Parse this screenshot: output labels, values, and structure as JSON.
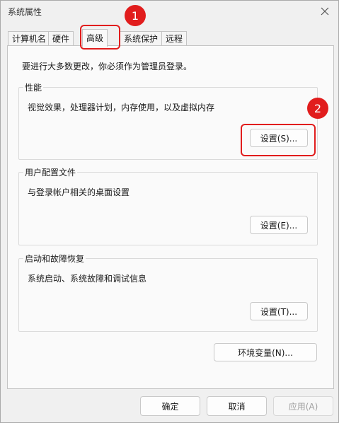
{
  "window": {
    "title": "系统属性"
  },
  "tabs": [
    {
      "label": "计算机名",
      "active": false
    },
    {
      "label": "硬件",
      "active": false
    },
    {
      "label": "高级",
      "active": true
    },
    {
      "label": "系统保护",
      "active": false
    },
    {
      "label": "远程",
      "active": false
    }
  ],
  "admin_note": "要进行大多数更改，你必须作为管理员登录。",
  "groups": {
    "performance": {
      "title": "性能",
      "desc": "视觉效果，处理器计划，内存使用，以及虚拟内存",
      "button": "设置(S)..."
    },
    "profiles": {
      "title": "用户配置文件",
      "desc": "与登录帐户相关的桌面设置",
      "button": "设置(E)..."
    },
    "startup": {
      "title": "启动和故障恢复",
      "desc": "系统启动、系统故障和调试信息",
      "button": "设置(T)..."
    }
  },
  "env_button": "环境变量(N)...",
  "footer": {
    "ok": "确定",
    "cancel": "取消",
    "apply": "应用(A)"
  },
  "annotations": {
    "step1": "1",
    "step2": "2",
    "color": "#e11d1d"
  }
}
